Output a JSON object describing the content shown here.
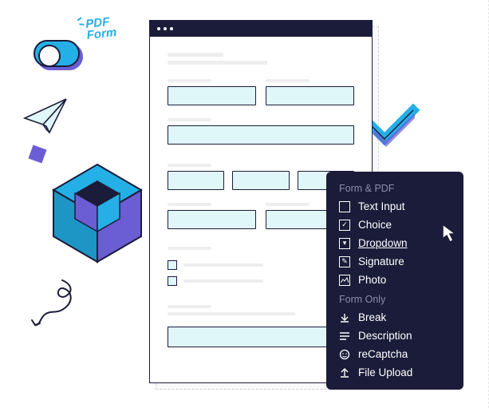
{
  "decor": {
    "handwrittenLabel": "PDF\nForm"
  },
  "menu": {
    "section1": "Form & PDF",
    "section2": "Form Only",
    "items1": [
      {
        "label": "Text Input",
        "icon": "text-input-icon"
      },
      {
        "label": "Choice",
        "icon": "choice-icon"
      },
      {
        "label": "Dropdown",
        "icon": "dropdown-icon",
        "active": true
      },
      {
        "label": "Signature",
        "icon": "signature-icon"
      },
      {
        "label": "Photo",
        "icon": "photo-icon"
      }
    ],
    "items2": [
      {
        "label": "Break",
        "icon": "break-icon"
      },
      {
        "label": "Description",
        "icon": "description-icon"
      },
      {
        "label": "reCaptcha",
        "icon": "recaptcha-icon"
      },
      {
        "label": "File Upload",
        "icon": "file-upload-icon"
      }
    ]
  }
}
